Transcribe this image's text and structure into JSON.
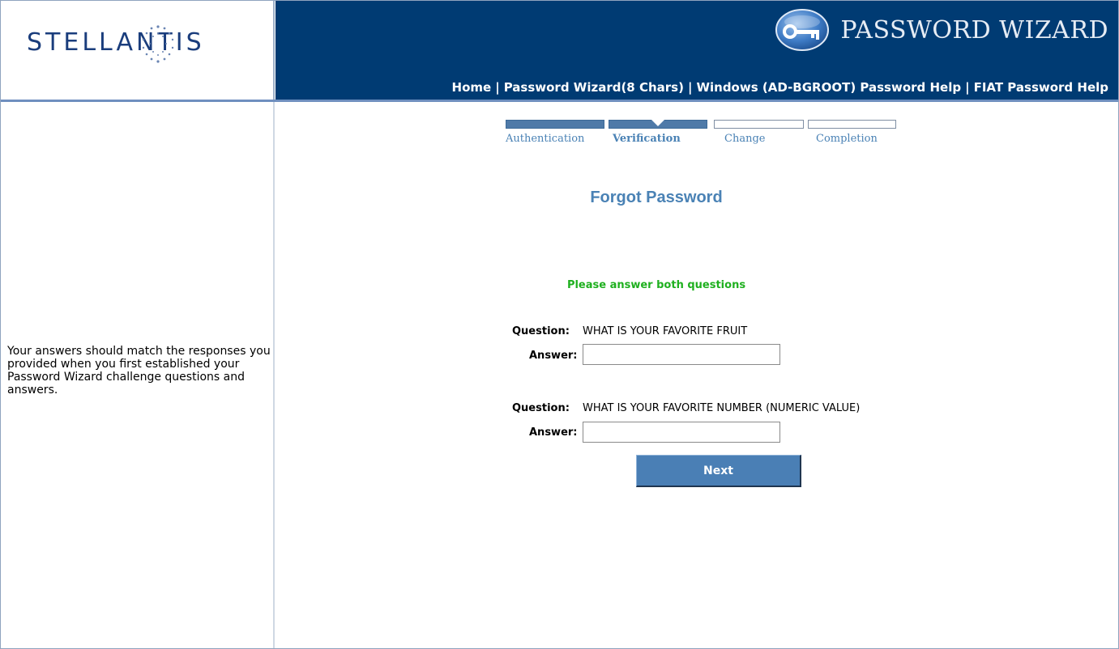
{
  "header": {
    "logo_text": "STELLANTIS",
    "app_title": "PASSWORD WIZARD",
    "nav": [
      {
        "label": "Home"
      },
      {
        "label": "Password Wizard(8 Chars)"
      },
      {
        "label": "Windows (AD-BGROOT) Password Help"
      },
      {
        "label": "FIAT Password Help"
      }
    ],
    "nav_separator": "|"
  },
  "sidebar": {
    "help_text": "Your answers should match the responses you provided when you first established your Password Wizard challenge questions and answers."
  },
  "wizard": {
    "steps": [
      {
        "label": "Authentication",
        "state": "done"
      },
      {
        "label": "Verification",
        "state": "current"
      },
      {
        "label": "Change",
        "state": "pending"
      },
      {
        "label": "Completion",
        "state": "pending"
      }
    ]
  },
  "form": {
    "title": "Forgot Password",
    "instruction": "Please answer both questions",
    "question_label": "Question:",
    "answer_label": "Answer:",
    "questions": [
      {
        "text": "WHAT IS YOUR FAVORITE FRUIT",
        "answer": ""
      },
      {
        "text": "WHAT IS YOUR FAVORITE NUMBER (NUMERIC VALUE)",
        "answer": ""
      }
    ],
    "next_label": "Next"
  },
  "colors": {
    "banner": "#003b73",
    "accent": "#4a82b5",
    "instruction": "#1fb01f"
  }
}
